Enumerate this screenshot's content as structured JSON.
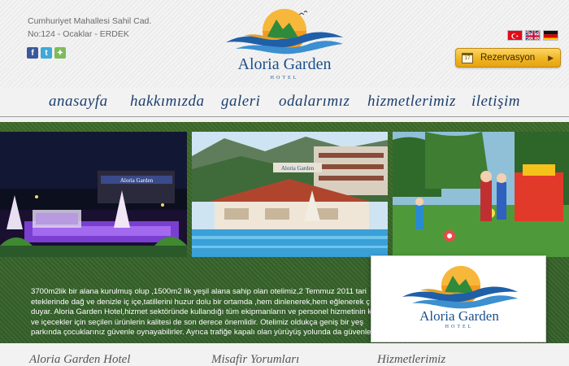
{
  "header": {
    "address_line1": "Cumhuriyet Mahallesi Sahil Cad.",
    "address_line2": "No:124 - Ocaklar - ERDEK",
    "social": [
      {
        "icon": "facebook-icon",
        "glyph": "f"
      },
      {
        "icon": "twitter-icon",
        "glyph": "t"
      },
      {
        "icon": "map-icon",
        "glyph": "✦"
      }
    ],
    "brand_name": "Aloria Garden",
    "brand_sub": "HOTEL",
    "languages": [
      "turkish-flag-icon",
      "english-flag-icon",
      "german-flag-icon"
    ],
    "reservation_label": "Rezervasyon",
    "reservation_icon_text": "17"
  },
  "nav": {
    "items": [
      "anasayfa",
      "hakkımızda",
      "galeri",
      "odalarımız",
      "hizmetlerimiz",
      "iletişim"
    ]
  },
  "gallery": {
    "photos": [
      "night-pool-photo",
      "daytime-pool-photo",
      "kids-playground-photo"
    ],
    "sign_text": "Aloria Garden"
  },
  "description": {
    "lines": [
      "3700m2lik bir alana kurulmuş olup ,1500m2 lik yeşil alana sahip olan otelimiz,2 Temmuz 2011 tari",
      "eteklerinde dağ ve denizle iç içe,tatillerini huzur dolu bir ortamda ,hem dinlenerek,hem eğlenerek ç",
      "duyar. Aloria Garden Hotel,hizmet sektöründe kullandığı tüm ekipmanların ve personel hizmetinin k",
      "ve içecekler için seçilen ürünlerin kalitesi de son derece önemlidir. Otelimiz oldukça geniş bir yeş",
      "parkında çocuklarınız güvenle oynayabilirler. Ayrıca trafiğe kapalı olan yürüyüş yolunda da güvenle"
    ]
  },
  "popup": {
    "brand_name": "Aloria Garden",
    "brand_sub": "HOTEL"
  },
  "bottom": {
    "headings": [
      "Aloria Garden Hotel",
      "Misafir Yorumları",
      "Hizmetlerimiz"
    ]
  },
  "colors": {
    "brand_blue": "#1c4f8c",
    "band_green": "#3d6b2a",
    "button_gold": "#f0b522"
  }
}
